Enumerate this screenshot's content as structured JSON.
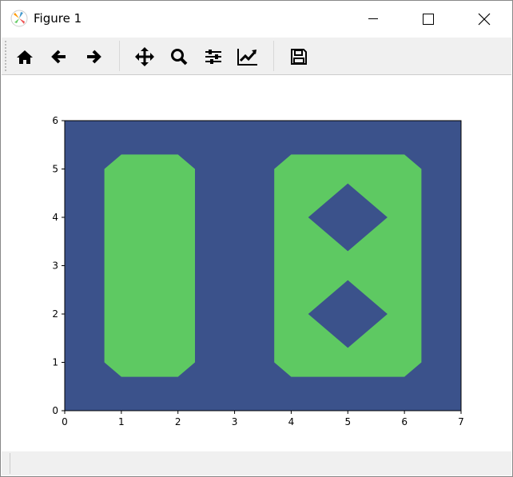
{
  "window": {
    "title": "Figure 1"
  },
  "toolbar": {
    "buttons": [
      "home-icon",
      "back-icon",
      "forward-icon",
      "pan-icon",
      "zoom-icon",
      "configure-subplots-icon",
      "edit-axes-icon",
      "save-icon"
    ]
  },
  "colors": {
    "background": "#3b528b",
    "fill": "#5ec962"
  },
  "chart_data": {
    "type": "contourf",
    "xlim": [
      0,
      7
    ],
    "ylim": [
      0,
      6
    ],
    "xticks": [
      "0",
      "1",
      "2",
      "3",
      "4",
      "5",
      "6",
      "7"
    ],
    "yticks": [
      "0",
      "1",
      "2",
      "3",
      "4",
      "5",
      "6"
    ],
    "regions": [
      {
        "level": "high",
        "polygon": [
          [
            0.7,
            1
          ],
          [
            1,
            0.7
          ],
          [
            2,
            0.7
          ],
          [
            2.3,
            1
          ],
          [
            2.3,
            5
          ],
          [
            2,
            5.3
          ],
          [
            1,
            5.3
          ],
          [
            0.7,
            5
          ]
        ]
      },
      {
        "level": "high",
        "polygon": [
          [
            3.7,
            1
          ],
          [
            4,
            0.7
          ],
          [
            6,
            0.7
          ],
          [
            6.3,
            1
          ],
          [
            6.3,
            5
          ],
          [
            6,
            5.3
          ],
          [
            4,
            5.3
          ],
          [
            3.7,
            5
          ]
        ],
        "holes": [
          [
            [
              4.3,
              4
            ],
            [
              5,
              4.7
            ],
            [
              5.7,
              4
            ],
            [
              5,
              3.3
            ]
          ],
          [
            [
              4.3,
              2
            ],
            [
              5,
              2.7
            ],
            [
              5.7,
              2
            ],
            [
              5,
              1.3
            ]
          ]
        ]
      }
    ]
  }
}
